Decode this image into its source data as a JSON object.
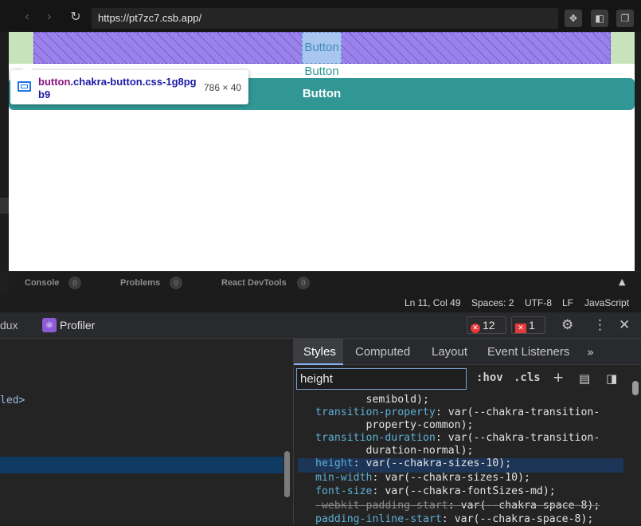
{
  "browser": {
    "url": "https://pt7zc7.csb.app/"
  },
  "preview": {
    "button_labels": [
      "Button",
      "Button",
      "Button"
    ],
    "tooltip": {
      "tag": "button",
      "classes": ".chakra-button.css-1g8pgb9",
      "dims": "786 × 40"
    }
  },
  "console_tabs": [
    {
      "label": "Console",
      "count": "0"
    },
    {
      "label": "Problems",
      "count": "0"
    },
    {
      "label": "React DevTools",
      "count": "0"
    }
  ],
  "status": {
    "position": "Ln 11, Col 49",
    "spaces": "Spaces: 2",
    "encoding": "UTF-8",
    "eol": "LF",
    "language": "JavaScript"
  },
  "devtools": {
    "left_tab_fragment": "dux",
    "profiler_label": "Profiler",
    "error_count": "12",
    "issue_count": "1",
    "elements_fragment": "led>",
    "styles_tabs": [
      "Styles",
      "Computed",
      "Layout",
      "Event Listeners"
    ],
    "filter_value": "height",
    "hov": ":hov",
    "cls": ".cls",
    "css_lines": [
      {
        "indent": "        ",
        "name": "",
        "value": "semibold);"
      },
      {
        "indent": "",
        "name": "transition-property",
        "value": "var(--chakra-transition-"
      },
      {
        "indent": "        ",
        "name": "",
        "value": "property-common);"
      },
      {
        "indent": "",
        "name": "transition-duration",
        "value": "var(--chakra-transition-"
      },
      {
        "indent": "        ",
        "name": "",
        "value": "duration-normal);"
      },
      {
        "indent": "",
        "name": "height",
        "value": "var(--chakra-sizes-10);"
      },
      {
        "indent": "",
        "name": "min-width",
        "value": "var(--chakra-sizes-10);"
      },
      {
        "indent": "",
        "name": "font-size",
        "value": "var(--chakra-fontSizes-md);"
      },
      {
        "indent": "",
        "name": "-webkit-padding-start",
        "value": "var(--chakra-space-8);"
      },
      {
        "indent": "",
        "name": "padding-inline-start",
        "value": "var(--chakra-space-8);"
      }
    ]
  }
}
